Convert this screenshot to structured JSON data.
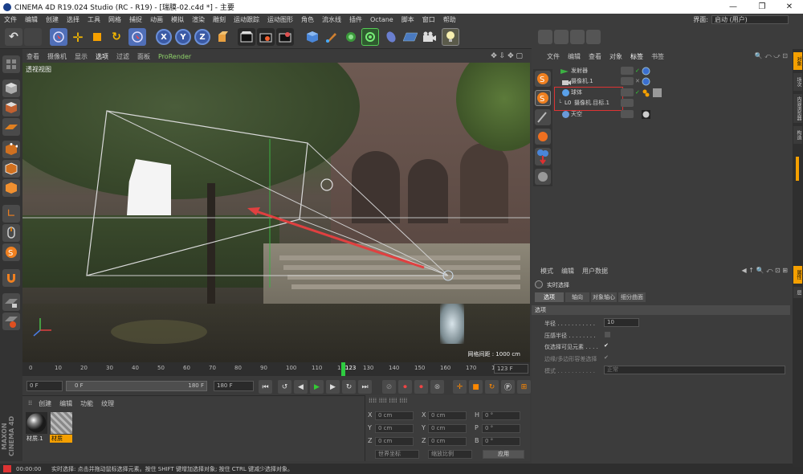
{
  "window": {
    "title": "CINEMA 4D R19.024 Studio (RC - R19) - [瑞膜-02.c4d *] - 主要",
    "minimize": "—",
    "maximize": "❐",
    "close": "✕"
  },
  "menu": {
    "items": [
      "文件",
      "编辑",
      "创建",
      "选择",
      "工具",
      "网格",
      "捕捉",
      "动画",
      "模拟",
      "渲染",
      "雕刻",
      "运动跟踪",
      "运动图形",
      "角色",
      "流水线",
      "插件",
      "Octane",
      "脚本",
      "窗口",
      "帮助"
    ],
    "layout_label": "界面:",
    "layout_value": "启动 (用户)"
  },
  "toolbar": {
    "undo": "↶",
    "axis_x": "X",
    "axis_y": "Y",
    "axis_z": "Z"
  },
  "viewport": {
    "menu": [
      "查看",
      "摄像机",
      "显示",
      "选项",
      "过滤",
      "面板",
      "ProRender"
    ],
    "label": "透视视图",
    "grid_info": "网格间距 : 1000 cm"
  },
  "timeline": {
    "ticks": [
      "0",
      "10",
      "20",
      "30",
      "40",
      "50",
      "60",
      "70",
      "80",
      "90",
      "100",
      "110",
      "120",
      "130",
      "140",
      "150",
      "160",
      "170",
      "180"
    ],
    "current_frame": "123",
    "current_frame_field": "123 F",
    "start_field": "0 F",
    "range_start": "0 F",
    "range_end": "180 F",
    "end_field": "180 F"
  },
  "materials": {
    "menu": [
      "创建",
      "编辑",
      "功能",
      "纹理"
    ],
    "items": [
      {
        "label": "材质.1"
      },
      {
        "label": "材质"
      }
    ]
  },
  "coords": {
    "rows": [
      {
        "a": "X",
        "av": "0 cm",
        "b": "X",
        "bv": "0 cm",
        "c": "H",
        "cv": "0 °"
      },
      {
        "a": "Y",
        "av": "0 cm",
        "b": "Y",
        "bv": "0 cm",
        "c": "P",
        "cv": "0 °"
      },
      {
        "a": "Z",
        "av": "0 cm",
        "b": "Z",
        "bv": "0 cm",
        "c": "B",
        "cv": "0 °"
      }
    ],
    "world": "世界坐标",
    "scale": "缩放比例",
    "apply": "应用"
  },
  "status": {
    "time": "00:00:00",
    "message": "实时选择: 点击并拖动鼠标选择元素。按住 SHIFT 键增加选择对象; 按住 CTRL 键减少选择对象。"
  },
  "objects": {
    "menu": [
      "文件",
      "编辑",
      "查看",
      "对象",
      "标签",
      "书签"
    ],
    "rows": [
      {
        "name": "发射器"
      },
      {
        "name": "摄像机.1"
      },
      {
        "name": "球体"
      },
      {
        "name": "摄像机.目标.1"
      },
      {
        "name": "天空"
      }
    ]
  },
  "attributes": {
    "menu": [
      "模式",
      "编辑",
      "用户数据"
    ],
    "tool_name": "实时选择",
    "tabs": [
      "选项",
      "轴向",
      "对象轴心",
      "细分曲面"
    ],
    "section": "选项",
    "fields": [
      {
        "label": "半径 . . . . . . . . . . .",
        "value": "10"
      },
      {
        "label": "压感半径 . . . . . . . .",
        "value": ""
      },
      {
        "label": "仅选择可见元素 . . . .",
        "value": "✔"
      },
      {
        "label": "边缘/多边形容差选择",
        "value": "✔"
      },
      {
        "label": "模式 . . . . . . . . . . .",
        "value": "正常"
      }
    ]
  },
  "side_tabs_top": [
    "对象",
    "场次",
    "内容浏览器",
    "构造"
  ],
  "side_tabs_bottom": [
    "属性",
    "层"
  ],
  "brand": "MAXON CINEMA 4D"
}
